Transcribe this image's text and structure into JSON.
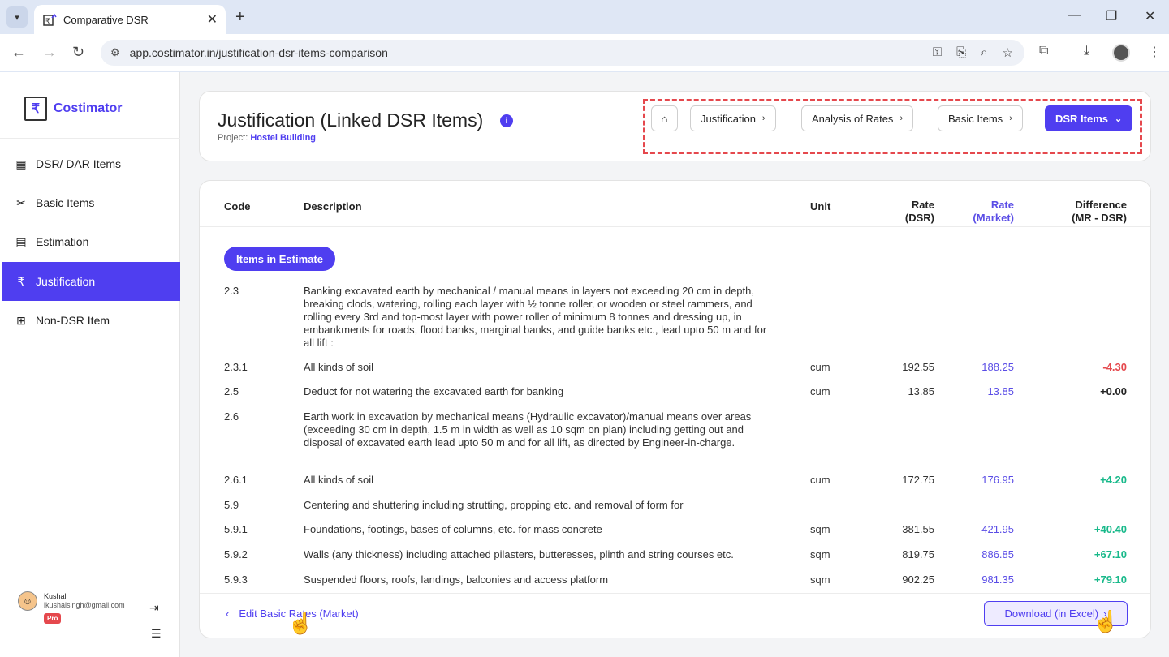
{
  "browser": {
    "tab_title": "Comparative DSR",
    "url": "app.costimator.in/justification-dsr-items-comparison"
  },
  "sidebar": {
    "logo_text": "Costimator",
    "items": [
      {
        "label": "DSR/ DAR Items",
        "icon": "grid-icon"
      },
      {
        "label": "Basic Items",
        "icon": "tools-icon"
      },
      {
        "label": "Estimation",
        "icon": "calculator-icon"
      },
      {
        "label": "Justification",
        "icon": "rupee-icon"
      },
      {
        "label": "Non-DSR Item",
        "icon": "add-box-icon"
      }
    ],
    "active": "Justification",
    "user": {
      "name": "Kushal",
      "email": "ikushalsingh@gmail.com",
      "badge": "Pro"
    }
  },
  "header": {
    "title": "Justification (Linked DSR Items)",
    "project_label": "Project:",
    "project_name": "Hostel Building",
    "breadcrumbs": [
      "Justification",
      "Analysis of Rates",
      "Basic Items",
      "DSR Items"
    ]
  },
  "table": {
    "columns": {
      "code": "Code",
      "description": "Description",
      "unit": "Unit",
      "rate_dsr_1": "Rate",
      "rate_dsr_2": "(DSR)",
      "rate_market_1": "Rate",
      "rate_market_2": "(Market)",
      "diff_1": "Difference",
      "diff_2": "(MR - DSR)"
    },
    "group_label": "Items in Estimate",
    "rows": [
      {
        "code": "2.3",
        "description": "Banking excavated earth by mechanical / manual means in layers not exceeding 20 cm in depth, breaking clods, watering, rolling each layer with ½ tonne roller, or wooden or steel rammers, and rolling every 3rd and top-most layer with power roller of minimum 8 tonnes and dressing up, in embankments for roads, flood banks, marginal banks, and guide banks etc., lead upto 50 m and for all lift :",
        "unit": "",
        "rate_dsr": "",
        "rate_market": "",
        "diff": ""
      },
      {
        "code": "2.3.1",
        "description": "All kinds of soil",
        "unit": "cum",
        "rate_dsr": "192.55",
        "rate_market": "188.25",
        "diff": "-4.30"
      },
      {
        "code": "2.5",
        "description": "Deduct for not watering the excavated earth for banking",
        "unit": "cum",
        "rate_dsr": "13.85",
        "rate_market": "13.85",
        "diff": "+0.00"
      },
      {
        "code": "2.6",
        "description": "Earth work in excavation by mechanical means (Hydraulic excavator)/manual means over areas (exceeding 30 cm in depth, 1.5 m in width as well as 10 sqm on plan) including getting out and disposal of excavated earth lead upto 50 m and for all lift, as directed by Engineer-in-charge.",
        "unit": "",
        "rate_dsr": "",
        "rate_market": "",
        "diff": ""
      },
      {
        "code": "2.6.1",
        "description": "All kinds of soil",
        "unit": "cum",
        "rate_dsr": "172.75",
        "rate_market": "176.95",
        "diff": "+4.20"
      },
      {
        "code": "5.9",
        "description": "Centering and shuttering including strutting, propping etc. and removal of form for",
        "unit": "",
        "rate_dsr": "",
        "rate_market": "",
        "diff": ""
      },
      {
        "code": "5.9.1",
        "description": "Foundations, footings, bases of columns, etc. for mass concrete",
        "unit": "sqm",
        "rate_dsr": "381.55",
        "rate_market": "421.95",
        "diff": "+40.40"
      },
      {
        "code": "5.9.2",
        "description": "Walls (any thickness) including attached pilasters, butteresses, plinth and string courses etc.",
        "unit": "sqm",
        "rate_dsr": "819.75",
        "rate_market": "886.85",
        "diff": "+67.10"
      },
      {
        "code": "5.9.3",
        "description": "Suspended floors, roofs, landings, balconies and access platform",
        "unit": "sqm",
        "rate_dsr": "902.25",
        "rate_market": "981.35",
        "diff": "+79.10"
      }
    ]
  },
  "footer": {
    "edit_link": "Edit Basic Rates (Market)",
    "download_button": "Download (in Excel)"
  },
  "colors": {
    "accent": "#4f3ef0",
    "negative": "#e5484d",
    "positive": "#18b98a"
  }
}
